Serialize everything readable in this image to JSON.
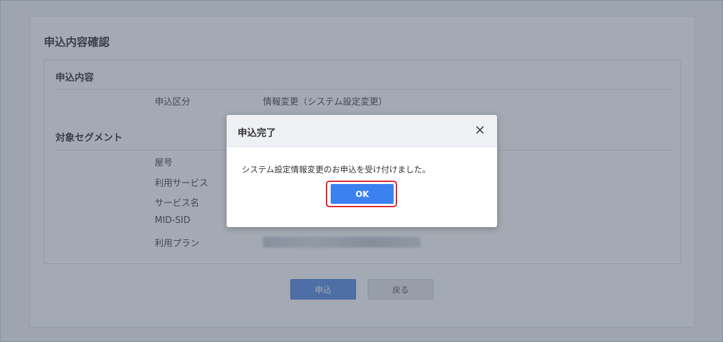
{
  "page": {
    "title": "申込内容確認",
    "application_section": {
      "title": "申込内容",
      "rows": [
        {
          "label": "申込区分",
          "value": "情報変更（システム設定変更）"
        }
      ]
    },
    "segment_section": {
      "title": "対象セグメント",
      "rows": [
        {
          "label": "屋号"
        },
        {
          "label": "利用サービス"
        },
        {
          "label": "サービス名"
        },
        {
          "label": "MID-SID"
        },
        {
          "label": "利用プラン"
        }
      ]
    },
    "buttons": {
      "submit_label": "申込",
      "back_label": "戻る"
    }
  },
  "modal": {
    "title": "申込完了",
    "close_icon": "close-icon",
    "message": "システム設定情報変更のお申込を受け付けました。",
    "ok_label": "OK",
    "highlight_color": "#e0262c"
  }
}
